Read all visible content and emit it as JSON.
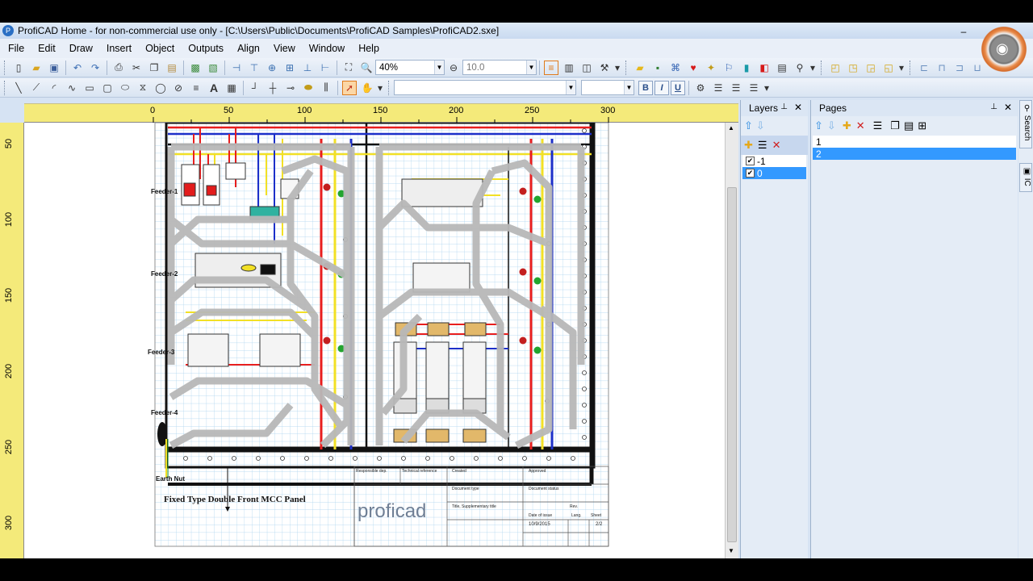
{
  "window": {
    "title": "ProfiCAD Home - for non-commercial use only - [C:\\Users\\Public\\Documents\\ProfiCAD Samples\\ProfiCAD2.sxe]",
    "minimize": "‒"
  },
  "menu": [
    "File",
    "Edit",
    "Draw",
    "Insert",
    "Object",
    "Outputs",
    "Align",
    "View",
    "Window",
    "Help"
  ],
  "toolbar": {
    "zoom_value": "40%",
    "grid_value": "10.0",
    "font_value": "",
    "font_size_value": "",
    "bold": "B",
    "italic": "I",
    "underline": "U"
  },
  "rulers": {
    "horizontal": [
      "0",
      "50",
      "100",
      "150",
      "200",
      "250",
      "300"
    ],
    "vertical": [
      "50",
      "100",
      "150",
      "200",
      "250",
      "300"
    ]
  },
  "drawing": {
    "feeder_labels": [
      "Feeder-1",
      "Feeder-2",
      "Feeder-3",
      "Feeder-4"
    ],
    "earth_label": "Earth Nut",
    "panel_title": "Fixed Type Double Front MCC Panel",
    "logo": "proficad",
    "title_block": {
      "responsible": "Responsible dep.",
      "technical_ref": "Technical reference",
      "created": "Created",
      "approved": "Approved",
      "document_type": "Document type",
      "document_status": "Document status",
      "title": "Title, Supplementary title",
      "rev": "Rev.",
      "date_of_issue_label": "Date of issue",
      "date_of_issue": "10/9/2015",
      "lang": "Lang.",
      "sheet_label": "Sheet",
      "sheet": "2/2"
    }
  },
  "layers": {
    "title": "Layers",
    "pin": "⊥",
    "close": "✕",
    "items": [
      {
        "label": "-1",
        "checked": true,
        "selected": false
      },
      {
        "label": "0",
        "checked": true,
        "selected": true
      }
    ]
  },
  "pages": {
    "title": "Pages",
    "pin": "⊥",
    "close": "✕",
    "items": [
      {
        "label": "1",
        "selected": false
      },
      {
        "label": "2",
        "selected": true
      }
    ]
  },
  "side_tabs": [
    "Search",
    "IC"
  ],
  "colors": {
    "ruler": "#f4ea7a",
    "selection": "#3399ff",
    "grid": "#a9d2ef",
    "wire_red": "#e81e1e",
    "wire_blue": "#1c2fc9",
    "wire_yellow": "#f2e025"
  }
}
